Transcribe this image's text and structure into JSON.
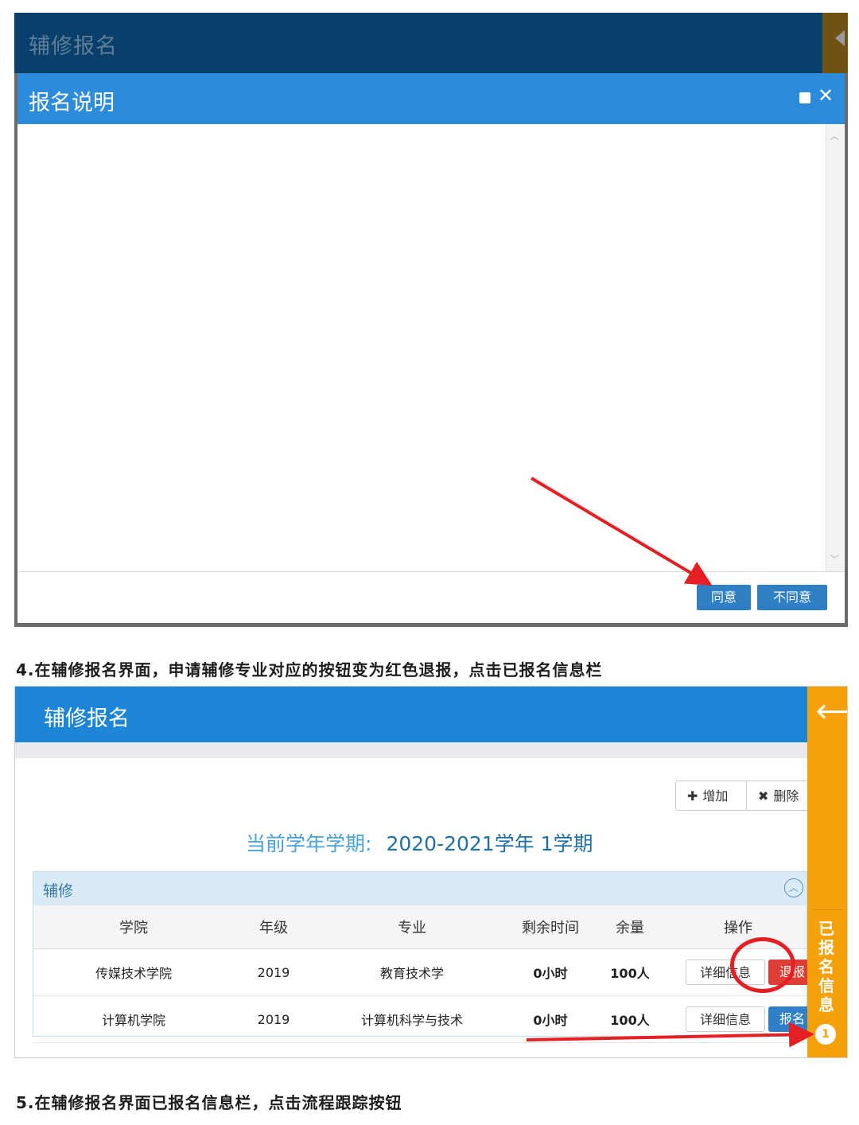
{
  "screenshot1": {
    "header_title": "辅修报名",
    "dialog": {
      "title": "报名说明",
      "agree_button": "同意",
      "disagree_button": "不同意"
    }
  },
  "caption4": "4.在辅修报名界面，申请辅修专业对应的按钮变为红色退报，点击已报名信息栏",
  "screenshot2": {
    "header_title": "辅修报名",
    "toolbar": {
      "add": "增加",
      "delete": "删除"
    },
    "term_label": "当前学年学期:",
    "term_value": "2020-2021学年 1学期",
    "panel_title": "辅修",
    "columns": [
      "学院",
      "年级",
      "专业",
      "剩余时间",
      "余量",
      "操作"
    ],
    "rows": [
      {
        "college": "传媒技术学院",
        "grade": "2019",
        "major": "教育技术学",
        "remaining": "0小时",
        "quota": "100人",
        "detail": "详细信息",
        "action": "退报"
      },
      {
        "college": "计算机学院",
        "grade": "2019",
        "major": "计算机科学与技术",
        "remaining": "0小时",
        "quota": "100人",
        "detail": "详细信息",
        "action": "报名"
      }
    ],
    "side_panel_label": "已报名信息",
    "side_panel_badge": "1",
    "colors": {
      "header": "#1d85d6",
      "side_panel": "#f6a10c",
      "withdraw": "#dc3e36",
      "enroll": "#2f80c7",
      "annotation": "#e51f24"
    }
  },
  "caption5": "5.在辅修报名界面已报名信息栏，点击流程跟踪按钮"
}
